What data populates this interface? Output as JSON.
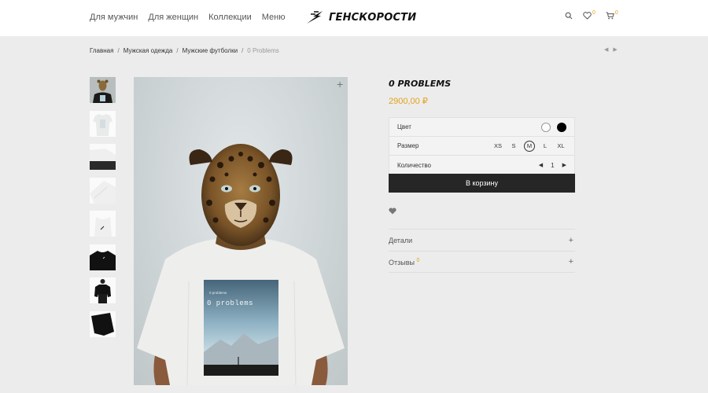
{
  "header": {
    "nav": [
      "Для мужчин",
      "Для женщин",
      "Коллекции",
      "Меню"
    ],
    "logo_text": "ГЕНСКОРОСТИ",
    "wishlist_count": "0",
    "cart_count": "0"
  },
  "breadcrumb": {
    "items": [
      "Главная",
      "Мужская одежда",
      "Мужские футболки"
    ],
    "current": "0 Problems"
  },
  "gallery": {
    "thumbnail_count": 8,
    "print_caption_small": "0 problems",
    "print_caption_large": "0 problems"
  },
  "product": {
    "title": "0 PROBLEMS",
    "price": "2900,00 ₽",
    "options": {
      "color_label": "Цвет",
      "colors": [
        "#ffffff",
        "#000000"
      ],
      "size_label": "Размер",
      "sizes": [
        "XS",
        "S",
        "M",
        "L",
        "XL"
      ],
      "selected_size": "M",
      "quantity_label": "Количество",
      "quantity": "1"
    },
    "add_to_cart": "В корзину",
    "details_label": "Детали",
    "reviews_label": "Отзывы",
    "reviews_count": "0"
  },
  "colors": {
    "accent": "#e3a31b",
    "button": "#262626"
  }
}
